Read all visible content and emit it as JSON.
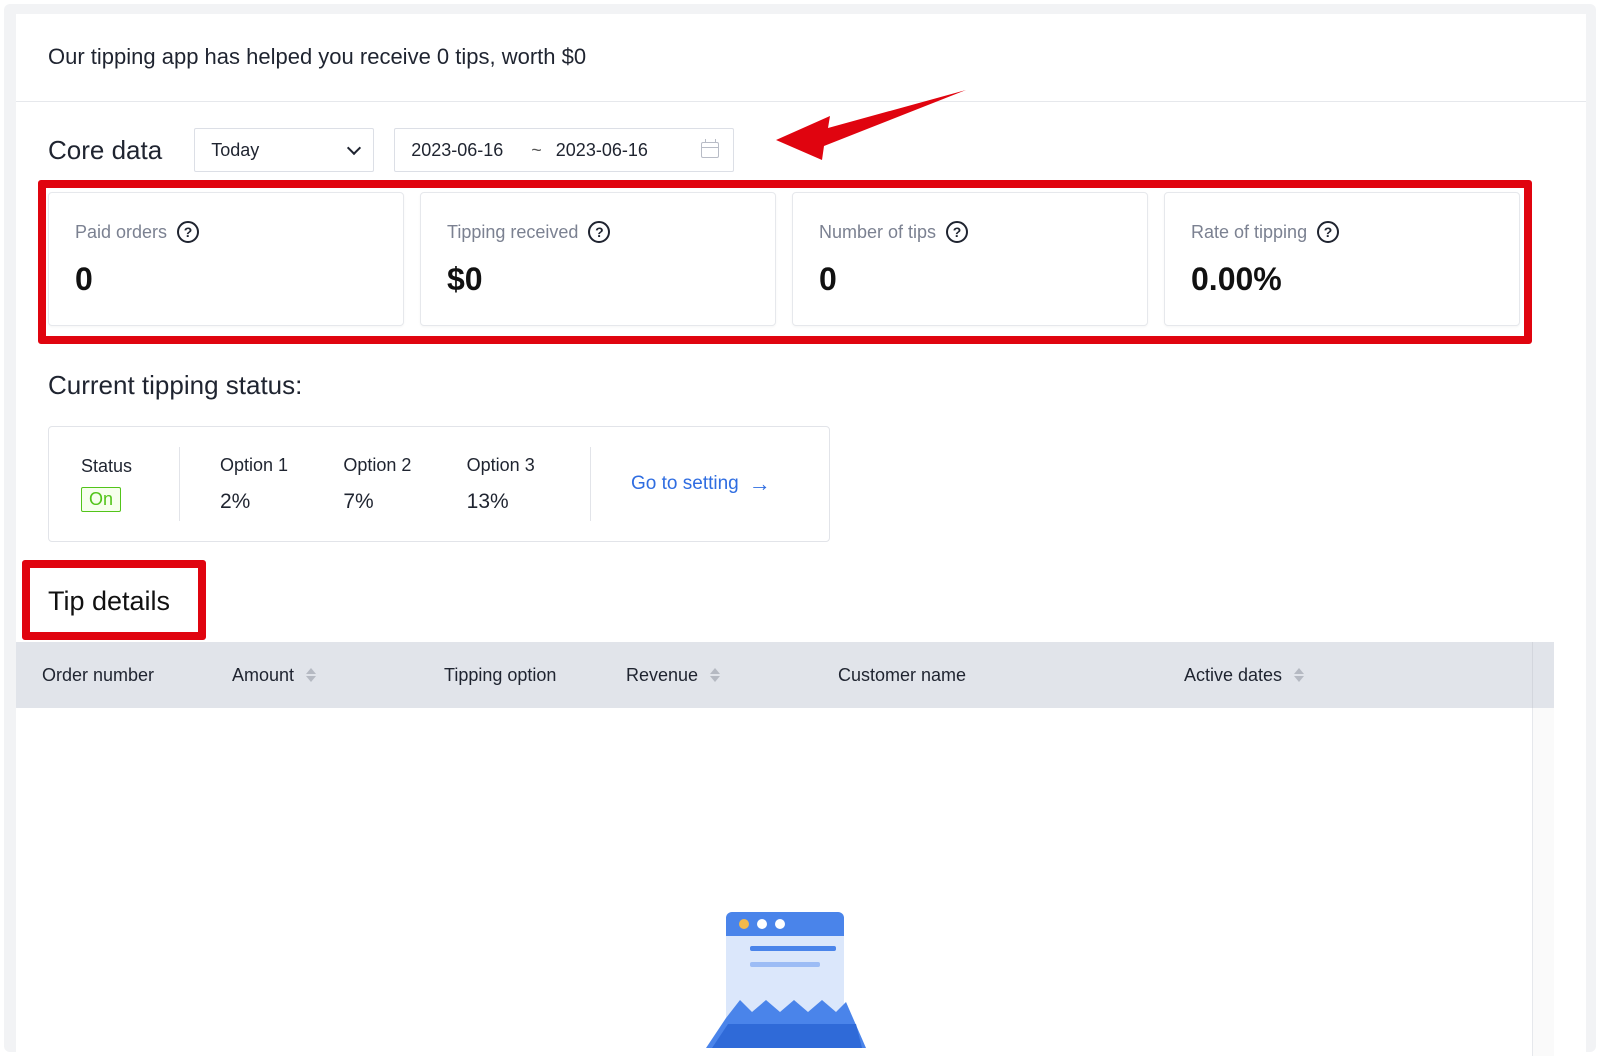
{
  "banner": {
    "text": "Our tipping app has helped you receive 0 tips, worth $0"
  },
  "core": {
    "title": "Core data",
    "period_select": {
      "value": "Today"
    },
    "date_range": {
      "start": "2023-06-16",
      "separator": "~",
      "end": "2023-06-16"
    }
  },
  "metrics": [
    {
      "label": "Paid orders",
      "value": "0"
    },
    {
      "label": "Tipping received",
      "value": "$0"
    },
    {
      "label": "Number of tips",
      "value": "0"
    },
    {
      "label": "Rate of tipping",
      "value": "0.00%"
    }
  ],
  "status": {
    "title": "Current tipping status:",
    "status_label": "Status",
    "status_value": "On",
    "options": [
      {
        "label": "Option 1",
        "value": "2%"
      },
      {
        "label": "Option 2",
        "value": "7%"
      },
      {
        "label": "Option 3",
        "value": "13%"
      }
    ],
    "go_to_setting": "Go to setting"
  },
  "tip_details": {
    "title": "Tip details",
    "columns": [
      "Order number",
      "Amount",
      "Tipping option",
      "Revenue",
      "Customer name",
      "Active dates"
    ]
  },
  "colors": {
    "annotation_red": "#e0040f",
    "link_blue": "#2f6de1",
    "status_green": "#52c41a",
    "table_header_bg": "#e1e4ea"
  },
  "icons": {
    "help": "question-circle-icon",
    "calendar": "calendar-icon",
    "chevron": "chevron-down-icon",
    "arrow": "arrow-right-icon",
    "sort": "sort-caret-icon"
  }
}
